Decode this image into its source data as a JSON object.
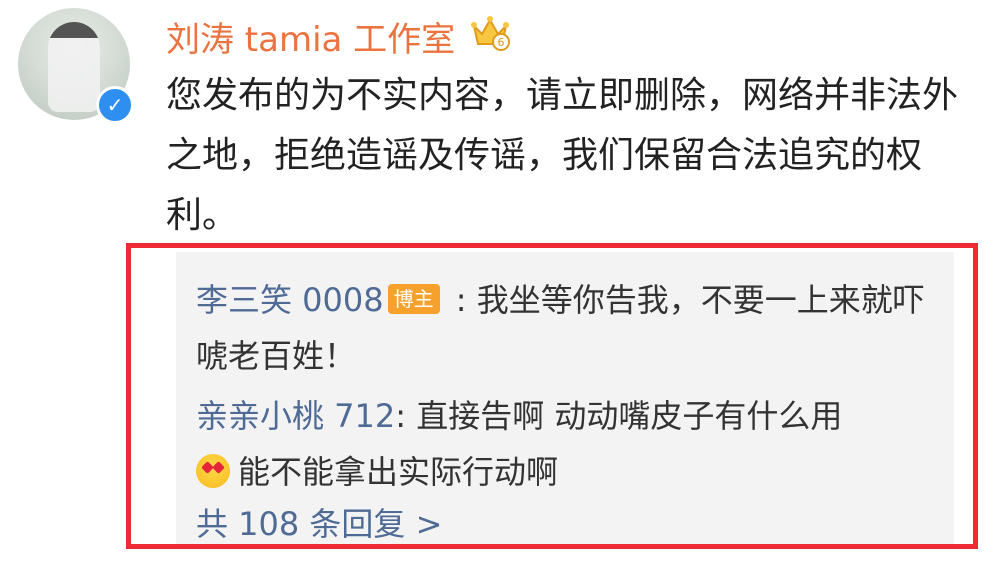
{
  "post": {
    "username": "刘涛 tamia 工作室",
    "verified_icon": "verified-check-icon",
    "crown_icon": "crown-icon",
    "crown_level": "6",
    "text": "您发布的为不实内容，请立即删除，网络并非法外之地，拒绝造谣及传谣，我们保留合法追究的权利。"
  },
  "comments": [
    {
      "author": "李三笑 0008",
      "tag": "博主",
      "separator": " : ",
      "text": "我坐等你告我，不要一上来就吓唬老百姓！"
    },
    {
      "author": "亲亲小桃 712",
      "separator": ": ",
      "text": "直接告啊 动动嘴皮子有什么用",
      "emoji": "heart-eyes-emoji",
      "text2": "能不能拿出实际行动啊"
    }
  ],
  "replies": {
    "label": "共 108 条回复 >"
  },
  "colors": {
    "username": "#eb7340",
    "link": "#4f6b95",
    "highlight": "#ee2a35",
    "verified": "#2f8ff0"
  }
}
